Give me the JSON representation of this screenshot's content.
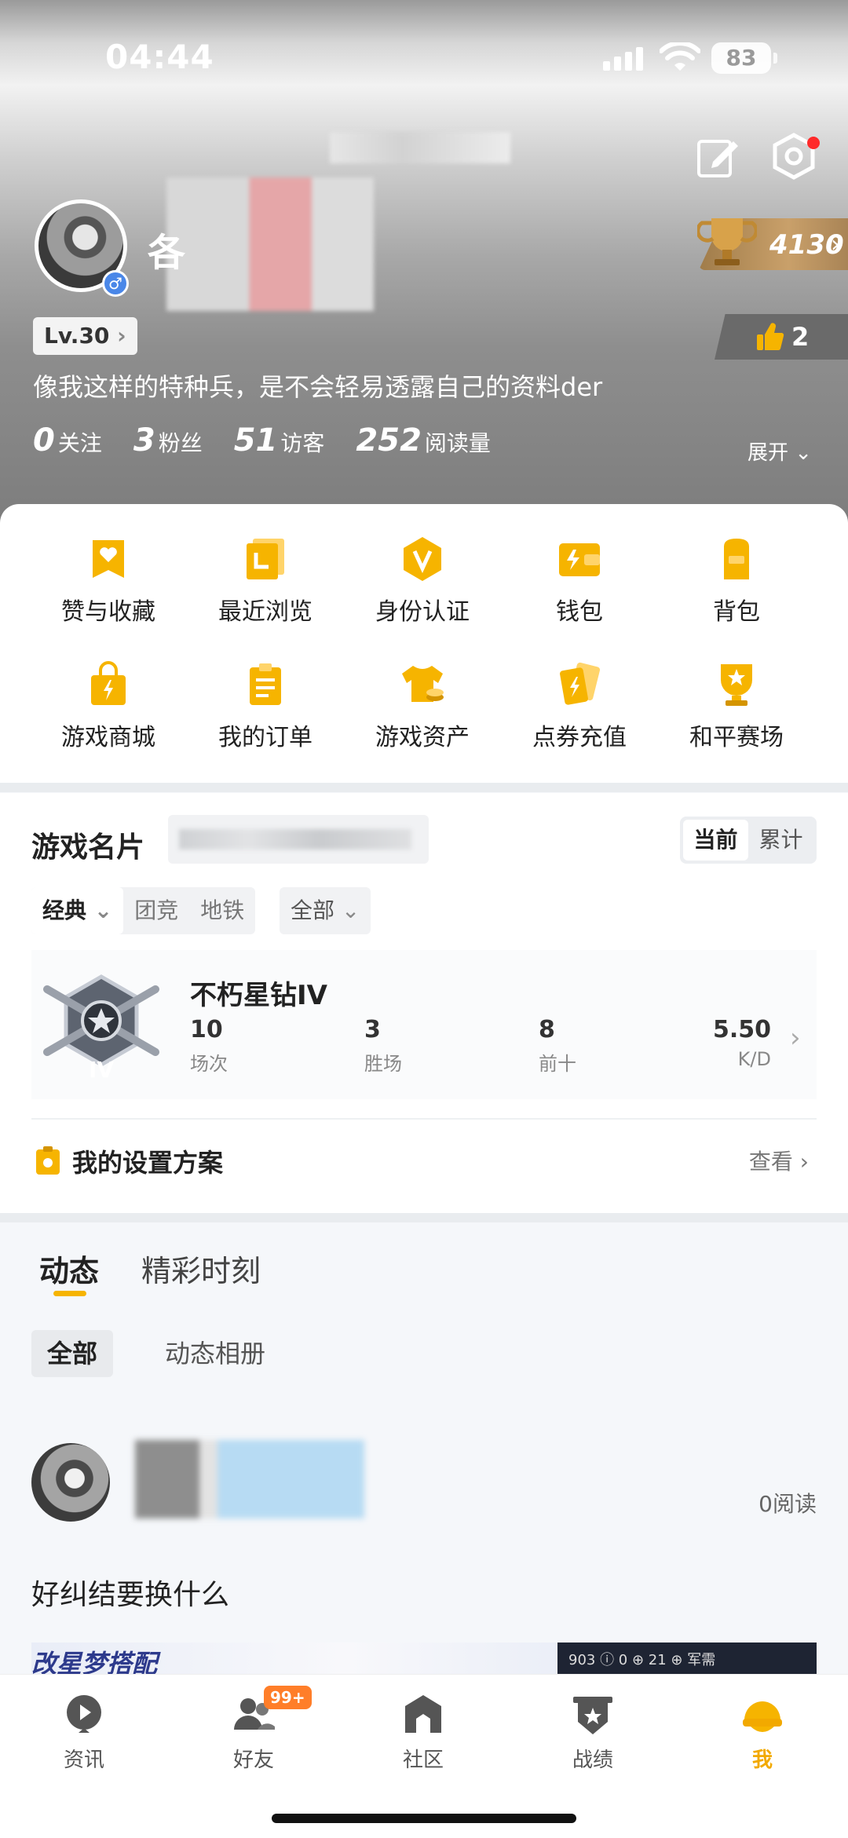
{
  "status": {
    "time": "04:44",
    "battery": "83"
  },
  "profile": {
    "name_visible": "各",
    "level": "Lv.30",
    "bio": "像我这样的特种兵，是不会轻易透露自己的资料der",
    "trophy": "4130",
    "likes": "2",
    "stats": [
      {
        "value": "0",
        "label": "关注"
      },
      {
        "value": "3",
        "label": "粉丝"
      },
      {
        "value": "51",
        "label": "访客"
      },
      {
        "value": "252",
        "label": "阅读量"
      }
    ],
    "expand": "展开"
  },
  "grid": [
    {
      "label": "赞与收藏",
      "icon": "heart-ribbon-icon"
    },
    {
      "label": "最近浏览",
      "icon": "history-card-icon"
    },
    {
      "label": "身份认证",
      "icon": "verified-badge-icon"
    },
    {
      "label": "钱包",
      "icon": "wallet-icon"
    },
    {
      "label": "背包",
      "icon": "backpack-icon"
    },
    {
      "label": "游戏商城",
      "icon": "shopping-bag-icon"
    },
    {
      "label": "我的订单",
      "icon": "order-clipboard-icon"
    },
    {
      "label": "游戏资产",
      "icon": "shirt-coins-icon"
    },
    {
      "label": "点券充值",
      "icon": "coupon-cards-icon"
    },
    {
      "label": "和平赛场",
      "icon": "trophy-star-icon"
    }
  ],
  "game_card": {
    "title": "游戏名片",
    "segment": {
      "current": "当前",
      "total": "累计"
    },
    "modes": [
      "经典",
      "团竞",
      "地铁"
    ],
    "scope": "全部",
    "rank": {
      "name": "不朽星钻IV",
      "stats": [
        {
          "value": "10",
          "label": "场次"
        },
        {
          "value": "3",
          "label": "胜场"
        },
        {
          "value": "8",
          "label": "前十"
        },
        {
          "value": "5.50",
          "label": "K/D"
        }
      ]
    },
    "settings_label": "我的设置方案",
    "settings_view": "查看"
  },
  "feed": {
    "tabs": [
      "动态",
      "精彩时刻"
    ],
    "chips": [
      "全部",
      "动态相册"
    ],
    "post": {
      "reads": "0阅读",
      "title": "好纠结要换什么",
      "image_text": "改星梦搭配",
      "image_right": "903 ⓘ 0 ⊕  21 ⊕ 军需"
    }
  },
  "nav": [
    {
      "label": "资讯",
      "icon": "news-play-icon"
    },
    {
      "label": "好友",
      "icon": "friends-icon",
      "badge": "99+"
    },
    {
      "label": "社区",
      "icon": "community-house-icon"
    },
    {
      "label": "战绩",
      "icon": "record-shield-icon"
    },
    {
      "label": "我",
      "icon": "me-helmet-icon"
    }
  ],
  "colors": {
    "accent": "#f6b400",
    "nav_active": "#f2a900",
    "badge": "#ff7e29"
  }
}
